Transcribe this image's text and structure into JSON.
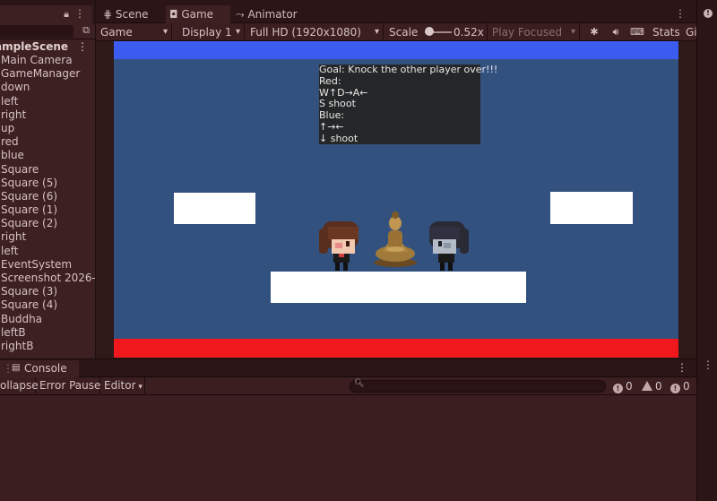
{
  "hierarchy": {
    "scene_name": "ampleScene",
    "items": [
      "Main Camera",
      "GameManager",
      "down",
      "left",
      "right",
      "up",
      "red",
      "blue",
      "Square",
      "Square (5)",
      "Square (6)",
      "Square (1)",
      "Square (2)",
      "right",
      "left",
      "EventSystem",
      "Screenshot 2026-0",
      "Square (3)",
      "Square (4)",
      "Buddha",
      "leftB",
      "rightB"
    ]
  },
  "tabs": {
    "scene": "Scene",
    "game": "Game",
    "animator": "Animator"
  },
  "toolbar": {
    "display_mode": "Game",
    "display": "Display 1",
    "resolution": "Full HD (1920x1080)",
    "scale_label": "Scale",
    "scale_value": "0.52x",
    "scale_fraction": 0.1,
    "play_mode": "Play Focused",
    "stats": "Stats",
    "gizmos": "Gi"
  },
  "game_text": {
    "goal": "Goal: Knock the other player over!!!",
    "red_label": "Red:",
    "red_move": "W↑D→A←",
    "red_shoot": "S shoot",
    "blue_label": "Blue:",
    "blue_move": "↑→←",
    "blue_shoot": "↓ shoot"
  },
  "colors": {
    "bg": "#33517f",
    "top_bar": "#3c5cf0",
    "bottom_bar": "#f0181c",
    "platform": "#ffffff"
  },
  "console": {
    "tab": "Console",
    "collapse": "ollapse",
    "error_pause": "Error Pause",
    "editor": "Editor",
    "errors": "0",
    "warnings": "0",
    "messages": "0"
  }
}
